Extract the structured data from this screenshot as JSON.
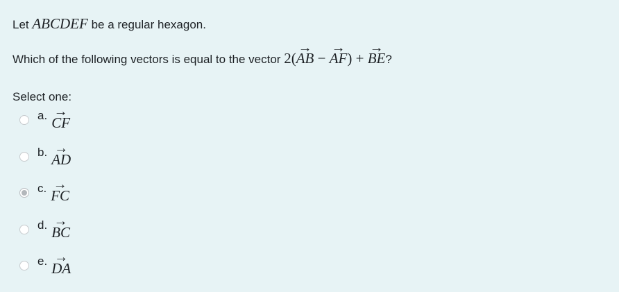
{
  "question": {
    "line1": {
      "prefix": "Let ",
      "math": "ABCDEF",
      "suffix": " be a regular hexagon."
    },
    "line2": {
      "text": "Which of the following vectors is equal to the vector ",
      "expr_coef": "2(",
      "vec1": "AB",
      "minus": " − ",
      "vec2": "AF",
      "close_plus": ") + ",
      "vec3": "BE",
      "end": "?"
    }
  },
  "prompt": "Select one:",
  "answers": [
    {
      "letter": "a.",
      "vector": "CF",
      "selected": false
    },
    {
      "letter": "b.",
      "vector": "AD",
      "selected": false
    },
    {
      "letter": "c.",
      "vector": "FC",
      "selected": true
    },
    {
      "letter": "d.",
      "vector": "BC",
      "selected": false
    },
    {
      "letter": "e.",
      "vector": "DA",
      "selected": false
    }
  ]
}
